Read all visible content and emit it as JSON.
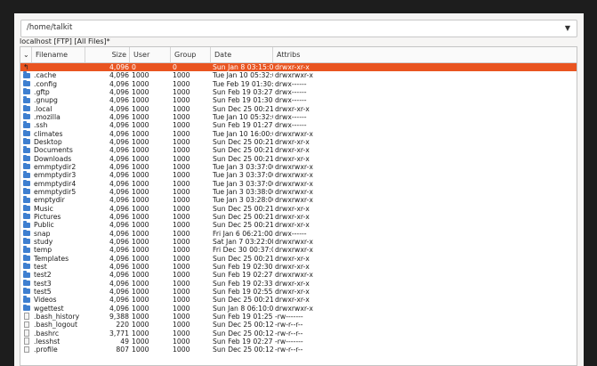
{
  "path": {
    "value": "/home/talkit"
  },
  "status": "localhost [FTP] [All Files]*",
  "icons": {
    "dropdown": "chevron-down-icon",
    "up": "parent-directory-icon",
    "folder": "folder-icon",
    "file": "file-icon"
  },
  "colors": {
    "selection": "#e95420",
    "folder": "#3e7fd0"
  },
  "columns": {
    "sort": "⌄",
    "filename": "Filename",
    "size": "Size",
    "user": "User",
    "group": "Group",
    "date": "Date",
    "attribs": "Attribs"
  },
  "rows": [
    {
      "type": "up",
      "name": "",
      "size": "4,096",
      "user": "0",
      "group": "0",
      "date": "Sun Jan 8 03:15:00",
      "attr": "drwxr-xr-x",
      "selected": true
    },
    {
      "type": "folder",
      "name": ".cache",
      "size": "4,096",
      "user": "1000",
      "group": "1000",
      "date": "Tue Jan 10 05:32:0",
      "attr": "drwxrwxr-x"
    },
    {
      "type": "folder",
      "name": ".config",
      "size": "4,096",
      "user": "1000",
      "group": "1000",
      "date": "Tue Feb 19 01:30:0",
      "attr": "drwx------"
    },
    {
      "type": "folder",
      "name": ".gftp",
      "size": "4,096",
      "user": "1000",
      "group": "1000",
      "date": "Sun Feb 19 03:27:0",
      "attr": "drwx------"
    },
    {
      "type": "folder",
      "name": ".gnupg",
      "size": "4,096",
      "user": "1000",
      "group": "1000",
      "date": "Sun Feb 19 01:30:0",
      "attr": "drwx------"
    },
    {
      "type": "folder",
      "name": ".local",
      "size": "4,096",
      "user": "1000",
      "group": "1000",
      "date": "Sun Dec 25 00:21:0",
      "attr": "drwxr-xr-x"
    },
    {
      "type": "folder",
      "name": ".mozilla",
      "size": "4,096",
      "user": "1000",
      "group": "1000",
      "date": "Tue Jan 10 05:32:0",
      "attr": "drwx------"
    },
    {
      "type": "folder",
      "name": ".ssh",
      "size": "4,096",
      "user": "1000",
      "group": "1000",
      "date": "Sun Feb 19 01:27:0",
      "attr": "drwx------"
    },
    {
      "type": "folder",
      "name": "climates",
      "size": "4,096",
      "user": "1000",
      "group": "1000",
      "date": "Tue Jan 10 16:00:0",
      "attr": "drwxrwxr-x"
    },
    {
      "type": "folder",
      "name": "Desktop",
      "size": "4,096",
      "user": "1000",
      "group": "1000",
      "date": "Sun Dec 25 00:21:0",
      "attr": "drwxr-xr-x"
    },
    {
      "type": "folder",
      "name": "Documents",
      "size": "4,096",
      "user": "1000",
      "group": "1000",
      "date": "Sun Dec 25 00:21:0",
      "attr": "drwxr-xr-x"
    },
    {
      "type": "folder",
      "name": "Downloads",
      "size": "4,096",
      "user": "1000",
      "group": "1000",
      "date": "Sun Dec 25 00:21:0",
      "attr": "drwxr-xr-x"
    },
    {
      "type": "folder",
      "name": "emmptydir2",
      "size": "4,096",
      "user": "1000",
      "group": "1000",
      "date": "Tue Jan 3 03:37:00",
      "attr": "drwxrwxr-x"
    },
    {
      "type": "folder",
      "name": "emmptydir3",
      "size": "4,096",
      "user": "1000",
      "group": "1000",
      "date": "Tue Jan 3 03:37:00",
      "attr": "drwxrwxr-x"
    },
    {
      "type": "folder",
      "name": "emmptydir4",
      "size": "4,096",
      "user": "1000",
      "group": "1000",
      "date": "Tue Jan 3 03:37:00",
      "attr": "drwxrwxr-x"
    },
    {
      "type": "folder",
      "name": "emmptydir5",
      "size": "4,096",
      "user": "1000",
      "group": "1000",
      "date": "Tue Jan 3 03:38:00",
      "attr": "drwxrwxr-x"
    },
    {
      "type": "folder",
      "name": "emptydir",
      "size": "4,096",
      "user": "1000",
      "group": "1000",
      "date": "Tue Jan 3 03:28:00",
      "attr": "drwxrwxr-x"
    },
    {
      "type": "folder",
      "name": "Music",
      "size": "4,096",
      "user": "1000",
      "group": "1000",
      "date": "Sun Dec 25 00:21:0",
      "attr": "drwxr-xr-x"
    },
    {
      "type": "folder",
      "name": "Pictures",
      "size": "4,096",
      "user": "1000",
      "group": "1000",
      "date": "Sun Dec 25 00:21:0",
      "attr": "drwxr-xr-x"
    },
    {
      "type": "folder",
      "name": "Public",
      "size": "4,096",
      "user": "1000",
      "group": "1000",
      "date": "Sun Dec 25 00:21:0",
      "attr": "drwxr-xr-x"
    },
    {
      "type": "folder",
      "name": "snap",
      "size": "4,096",
      "user": "1000",
      "group": "1000",
      "date": "Fri Jan 6 06:21:00",
      "attr": "drwx------"
    },
    {
      "type": "folder",
      "name": "study",
      "size": "4,096",
      "user": "1000",
      "group": "1000",
      "date": "Sat Jan 7 03:22:00",
      "attr": "drwxrwxr-x"
    },
    {
      "type": "folder",
      "name": "temp",
      "size": "4,096",
      "user": "1000",
      "group": "1000",
      "date": "Fri Dec 30 00:37:00",
      "attr": "drwxrwxr-x"
    },
    {
      "type": "folder",
      "name": "Templates",
      "size": "4,096",
      "user": "1000",
      "group": "1000",
      "date": "Sun Dec 25 00:21:0",
      "attr": "drwxr-xr-x"
    },
    {
      "type": "folder",
      "name": "test",
      "size": "4,096",
      "user": "1000",
      "group": "1000",
      "date": "Sun Feb 19 02:30:0",
      "attr": "drwxr-xr-x"
    },
    {
      "type": "folder",
      "name": "test2",
      "size": "4,096",
      "user": "1000",
      "group": "1000",
      "date": "Sun Feb 19 02:27:0",
      "attr": "drwxrwxr-x"
    },
    {
      "type": "folder",
      "name": "test3",
      "size": "4,096",
      "user": "1000",
      "group": "1000",
      "date": "Sun Feb 19 02:33:0",
      "attr": "drwxr-xr-x"
    },
    {
      "type": "folder",
      "name": "test5",
      "size": "4,096",
      "user": "1000",
      "group": "1000",
      "date": "Sun Feb 19 02:55:0",
      "attr": "drwxr-xr-x"
    },
    {
      "type": "folder",
      "name": "Videos",
      "size": "4,096",
      "user": "1000",
      "group": "1000",
      "date": "Sun Dec 25 00:21:0",
      "attr": "drwxr-xr-x"
    },
    {
      "type": "folder",
      "name": "wgettest",
      "size": "4,096",
      "user": "1000",
      "group": "1000",
      "date": "Sun Jan 8 06:10:00",
      "attr": "drwxrwxr-x"
    },
    {
      "type": "file",
      "name": ".bash_history",
      "size": "9,388",
      "user": "1000",
      "group": "1000",
      "date": "Sun Feb 19 01:25:0",
      "attr": "-rw-------"
    },
    {
      "type": "file",
      "name": ".bash_logout",
      "size": "220",
      "user": "1000",
      "group": "1000",
      "date": "Sun Dec 25 00:12:0",
      "attr": "-rw-r--r--"
    },
    {
      "type": "file",
      "name": ".bashrc",
      "size": "3,771",
      "user": "1000",
      "group": "1000",
      "date": "Sun Dec 25 00:12:0",
      "attr": "-rw-r--r--"
    },
    {
      "type": "file",
      "name": ".lesshst",
      "size": "49",
      "user": "1000",
      "group": "1000",
      "date": "Sun Feb 19 02:27:0",
      "attr": "-rw-------"
    },
    {
      "type": "file",
      "name": ".profile",
      "size": "807",
      "user": "1000",
      "group": "1000",
      "date": "Sun Dec 25 00:12:0",
      "attr": "-rw-r--r--"
    }
  ]
}
